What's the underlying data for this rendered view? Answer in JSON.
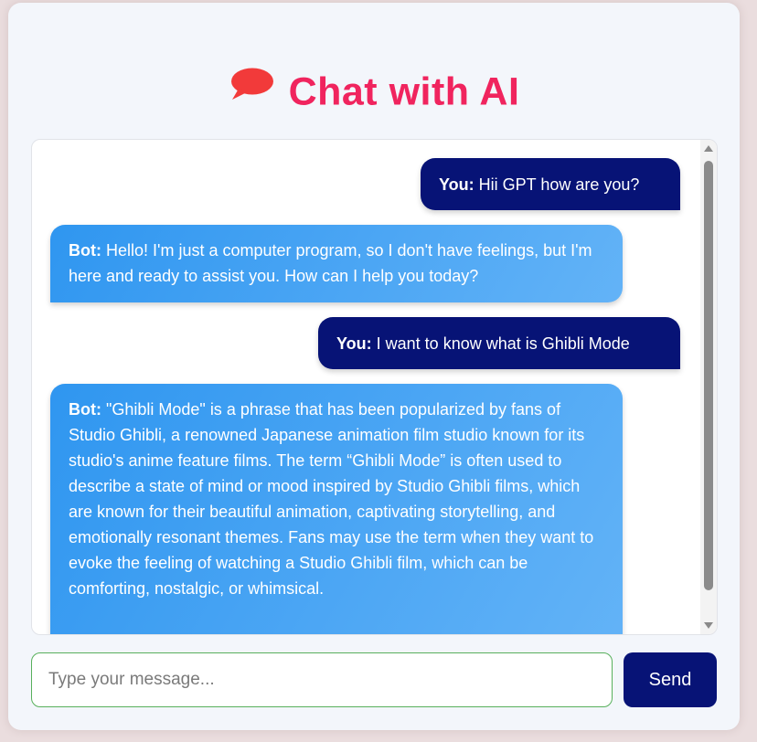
{
  "header": {
    "title": "Chat with AI",
    "icon": "speech-bubble-icon",
    "title_color": "#f0245e"
  },
  "messages": [
    {
      "sender": "You:",
      "text": " Hii GPT how are you?",
      "role": "user"
    },
    {
      "sender": "Bot:",
      "text": " Hello! I'm just a computer program, so I don't have feelings, but I'm here and ready to assist you. How can I help you today?",
      "role": "bot"
    },
    {
      "sender": "You:",
      "text": " I want to know what is Ghibli Mode",
      "role": "user"
    },
    {
      "sender": "Bot:",
      "text": " \"Ghibli Mode\" is a phrase that has been popularized by fans of Studio Ghibli, a renowned Japanese animation film studio known for its studio's anime feature films. The term “Ghibli Mode” is often used to describe a state of mind or mood inspired by Studio Ghibli films, which are known for their beautiful animation, captivating storytelling, and emotionally resonant themes. Fans may use the term when they want to evoke the feeling of watching a Studio Ghibli film, which can be comforting, nostalgic, or whimsical.",
      "role": "bot"
    }
  ],
  "composer": {
    "placeholder": "Type your message...",
    "value": "",
    "send_label": "Send"
  },
  "colors": {
    "user_bubble": "#071376",
    "bot_bubble_start": "#2f96f0",
    "bot_bubble_end": "#63b3f7",
    "input_border": "#58b05c"
  }
}
